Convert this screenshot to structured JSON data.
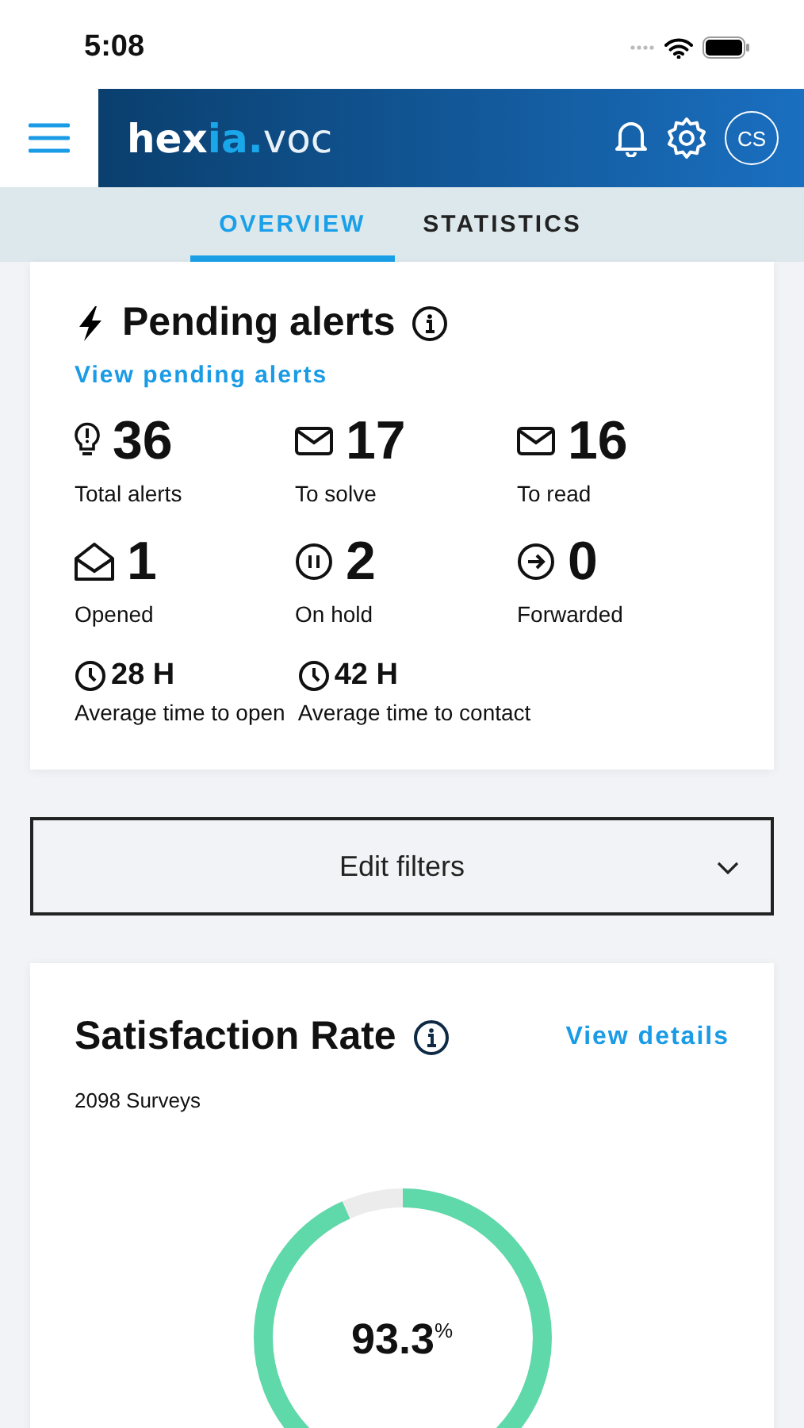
{
  "status_bar": {
    "time": "5:08"
  },
  "header": {
    "logo_a": "hex",
    "logo_b": "ia.",
    "logo_c": "voc",
    "avatar": "CS"
  },
  "tabs": [
    {
      "label": "OVERVIEW",
      "selected": true
    },
    {
      "label": "STATISTICS",
      "selected": false
    }
  ],
  "pending_alerts": {
    "title": "Pending alerts",
    "link": "View pending alerts",
    "stats": [
      {
        "value": "36",
        "label": "Total alerts"
      },
      {
        "value": "17",
        "label": "To solve"
      },
      {
        "value": "16",
        "label": "To read"
      },
      {
        "value": "1",
        "label": "Opened"
      },
      {
        "value": "2",
        "label": "On hold"
      },
      {
        "value": "0",
        "label": "Forwarded"
      }
    ],
    "times": [
      {
        "value": "28 H",
        "label": "Average time to open"
      },
      {
        "value": "42 H",
        "label": "Average time to contact"
      }
    ]
  },
  "filters": {
    "label": "Edit filters"
  },
  "satisfaction": {
    "title": "Satisfaction Rate",
    "link": "View details",
    "surveys": "2098 Surveys",
    "gauge": {
      "value": "93.3",
      "unit": "%"
    }
  }
}
